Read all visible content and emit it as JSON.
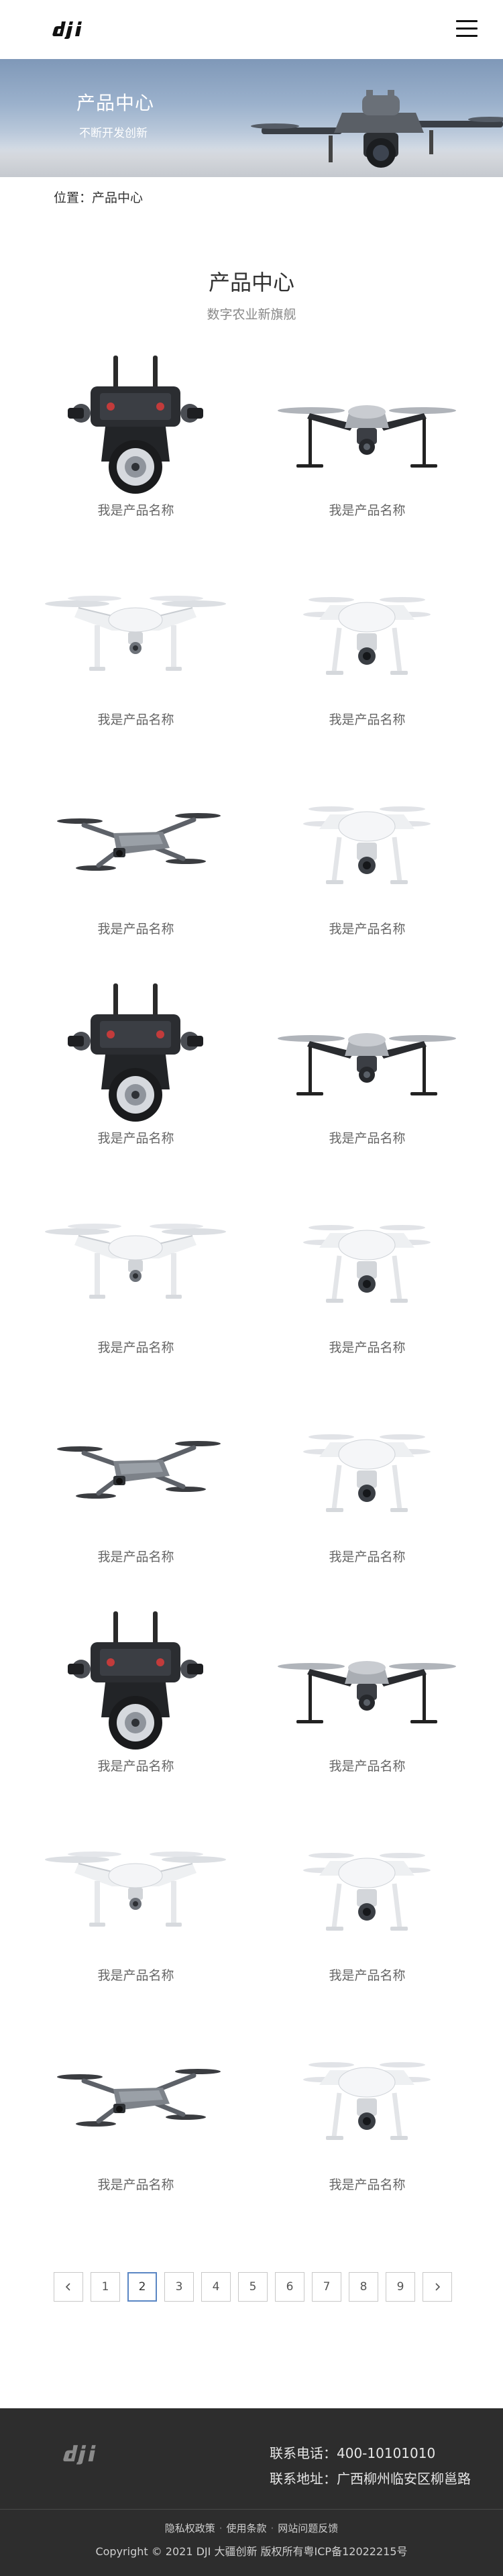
{
  "header": {
    "logo_icon": "dji-logo",
    "menu_icon": "hamburger-menu-icon"
  },
  "banner": {
    "title": "产品中心",
    "subtitle": "不断开发创新"
  },
  "breadcrumb": {
    "prefix": "位置：",
    "current": "产品中心"
  },
  "section": {
    "title": "产品中心",
    "subtitle": "数字农业新旗舰"
  },
  "products": [
    {
      "name": "我是产品名称",
      "image": "controller-gimbal"
    },
    {
      "name": "我是产品名称",
      "image": "inspire-drone"
    },
    {
      "name": "我是产品名称",
      "image": "phantom-drone"
    },
    {
      "name": "我是产品名称",
      "image": "phantom-front-drone"
    },
    {
      "name": "我是产品名称",
      "image": "mavic-drone"
    },
    {
      "name": "我是产品名称",
      "image": "phantom-front-drone"
    },
    {
      "name": "我是产品名称",
      "image": "controller-gimbal"
    },
    {
      "name": "我是产品名称",
      "image": "inspire-drone"
    },
    {
      "name": "我是产品名称",
      "image": "phantom-drone"
    },
    {
      "name": "我是产品名称",
      "image": "phantom-front-drone"
    },
    {
      "name": "我是产品名称",
      "image": "mavic-drone"
    },
    {
      "name": "我是产品名称",
      "image": "phantom-front-drone"
    },
    {
      "name": "我是产品名称",
      "image": "controller-gimbal"
    },
    {
      "name": "我是产品名称",
      "image": "inspire-drone"
    },
    {
      "name": "我是产品名称",
      "image": "phantom-drone"
    },
    {
      "name": "我是产品名称",
      "image": "phantom-front-drone"
    },
    {
      "name": "我是产品名称",
      "image": "mavic-drone"
    },
    {
      "name": "我是产品名称",
      "image": "phantom-front-drone"
    }
  ],
  "pagination": {
    "prev_icon": "chevron-left-icon",
    "next_icon": "chevron-right-icon",
    "pages": [
      "1",
      "2",
      "3",
      "4",
      "5",
      "6",
      "7",
      "8",
      "9"
    ],
    "current": "2"
  },
  "footer": {
    "logo_icon": "dji-logo",
    "phone_label": "联系电话：",
    "phone": "400-10101010",
    "address_label": "联系地址：",
    "address": "广西柳州临安区柳邕路",
    "links": [
      "隐私权政策",
      "使用条款",
      "网站问题反馈"
    ],
    "link_separator": "·",
    "copyright": "Copyright © 2021 DJI 大疆创新 版权所有粤ICP备12022215号"
  },
  "colors": {
    "footer_bg": "#2d2d2d",
    "active_page_border": "#5a86c4",
    "banner_sky": "#9bb1cc"
  }
}
